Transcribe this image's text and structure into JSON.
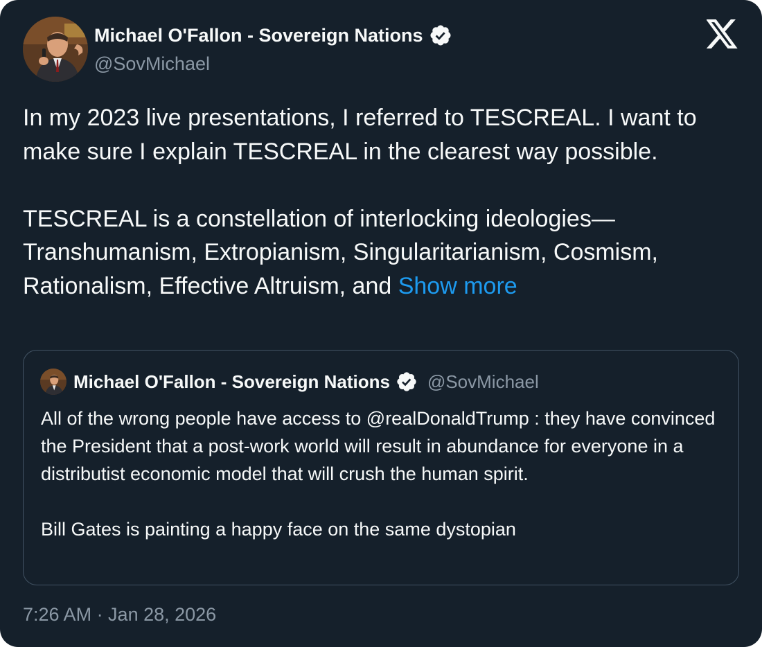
{
  "author": {
    "name": "Michael O'Fallon - Sovereign Nations",
    "handle": "@SovMichael",
    "verified": true
  },
  "tweet": {
    "paragraph1": "In my 2023 live presentations, I referred to TESCREAL. I want to make sure I explain TESCREAL in the clearest way possible.",
    "paragraph2": "TESCREAL is a constellation of interlocking ideologies—Transhumanism, Extropianism, Singularitarianism, Cosmism, Rationalism, Effective Altruism, and",
    "show_more_label": "Show more"
  },
  "quoted_tweet": {
    "name": "Michael O'Fallon - Sovereign Nations",
    "handle": "@SovMichael",
    "verified": true,
    "paragraph1": "All of the wrong people have access to @realDonaldTrump : they have convinced the President that a post-work world will result in abundance for everyone in a distributist economic model that will crush the human spirit.",
    "paragraph2": "Bill Gates is painting a happy face on the same dystopian"
  },
  "timestamp": "7:26 AM · Jan 28, 2026",
  "icons": {
    "brand": "x-logo-icon",
    "verified": "verified-badge-icon"
  },
  "colors": {
    "background": "#15202b",
    "text": "#f7f9f9",
    "secondary_text": "#8b98a5",
    "link": "#1d9bf0",
    "border": "#425364"
  }
}
